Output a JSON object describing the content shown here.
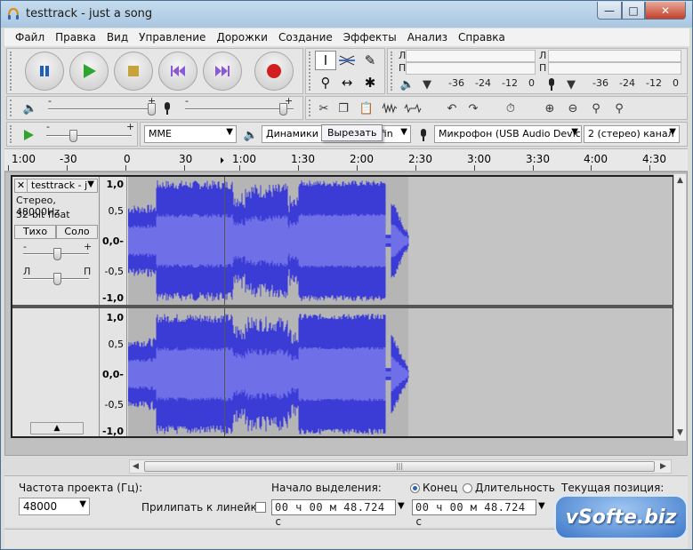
{
  "window": {
    "title": "testtrack - just a song",
    "min_glyph": "—",
    "max_glyph": "□",
    "close_glyph": "✕"
  },
  "menu": [
    "Файл",
    "Правка",
    "Вид",
    "Управление",
    "Дорожки",
    "Создание",
    "Эффекты",
    "Анализ",
    "Справка"
  ],
  "meters": {
    "record_l": "Л",
    "record_r": "П",
    "play_l": "Л",
    "play_r": "П",
    "record_ticks": [
      "-36",
      "-24",
      "-12",
      "0"
    ],
    "play_ticks": [
      "-36",
      "-24",
      "-12",
      "0"
    ]
  },
  "mixer": {
    "minus": "-",
    "plus": "+"
  },
  "device": {
    "host": "MME",
    "output": "Динамики (R",
    "output_suffix": "efin",
    "input": "Микрофон (USB Audio Device)",
    "channels": "2 (стерео) канал"
  },
  "tooltip": "Вырезать",
  "ruler": [
    "1:00",
    "-30",
    "0",
    "30",
    "1:00",
    "1:30",
    "2:00",
    "2:30",
    "3:00",
    "3:30",
    "4:00",
    "4:30"
  ],
  "track": {
    "name": "testtrack - j",
    "format": "Стерео, 48000Hz",
    "bits": "32-bit float",
    "mute": "Тихо",
    "solo": "Соло",
    "gain_minus": "-",
    "gain_plus": "+",
    "pan_left": "Л",
    "pan_right": "П",
    "collapse": "▲",
    "y_top": [
      "1,0",
      "0,5",
      "0,0-",
      "-0,5",
      "-1,0"
    ],
    "y_bottom": [
      "1,0",
      "0,5",
      "0,0-",
      "-0,5",
      "-1,0"
    ]
  },
  "selection": {
    "rate_label": "Частота проекта (Гц):",
    "rate_value": "48000",
    "snap_label": "Прилипать к линейке",
    "start_label": "Начало выделения:",
    "end_label": "Конец",
    "length_label": "Длительность",
    "position_label": "Текущая позиция:",
    "start_value": "00 ч 00 м 48.724 с",
    "end_value": "00 ч 00 м 48.724 с"
  },
  "watermark": "vSofte.biz",
  "colors": {
    "waveform": "#3b3bd6",
    "waveform_rms": "#6f6fe8",
    "record": "#d11e1e",
    "play": "#2fa52f"
  }
}
